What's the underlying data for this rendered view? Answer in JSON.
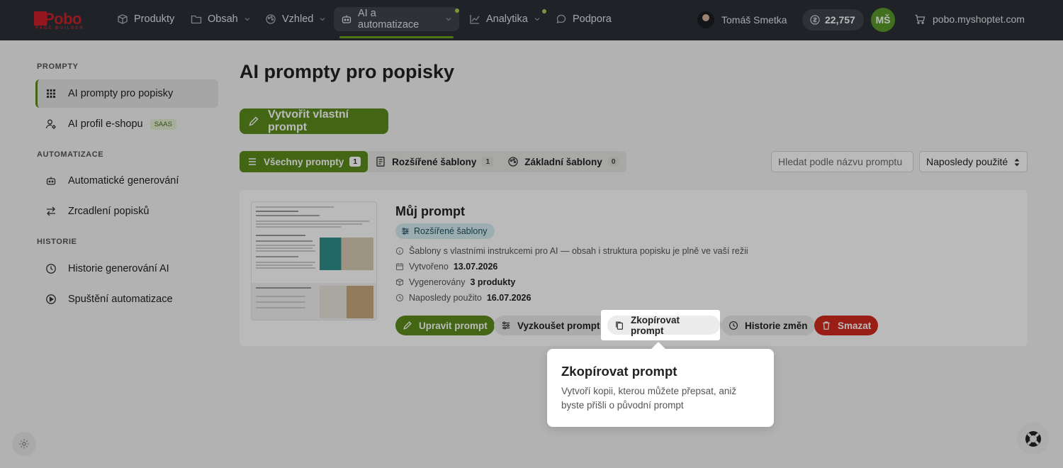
{
  "topbar": {
    "logo": {
      "text": "Pobo",
      "subtext": "PAGE BUILDER"
    },
    "nav": [
      {
        "label": "Produkty",
        "icon": "box-icon"
      },
      {
        "label": "Obsah",
        "icon": "folder-icon"
      },
      {
        "label": "Vzhled",
        "icon": "palette-icon"
      },
      {
        "label": "AI a automatizace",
        "icon": "robot-icon",
        "active": true
      },
      {
        "label": "Analytika",
        "icon": "chart-icon"
      },
      {
        "label": "Podpora",
        "icon": "chat-icon"
      }
    ],
    "user_name": "Tomáš Smetka",
    "credits": "22,757",
    "initials": "MŠ",
    "shop": "pobo.myshoptet.com"
  },
  "sidebar": {
    "sections": [
      {
        "title": "PROMPTY",
        "items": [
          {
            "label": "AI prompty pro popisky",
            "icon": "grid-icon",
            "active": true
          },
          {
            "label": "AI profil e-shopu",
            "icon": "user-gear-icon",
            "badge": "SAAS"
          }
        ]
      },
      {
        "title": "AUTOMATIZACE",
        "items": [
          {
            "label": "Automatické generování",
            "icon": "robot-icon"
          },
          {
            "label": "Zrcadlení popisků",
            "icon": "swap-icon"
          }
        ]
      },
      {
        "title": "HISTORIE",
        "items": [
          {
            "label": "Historie generování AI",
            "icon": "clock-icon"
          },
          {
            "label": "Spuštění automatizace",
            "icon": "play-icon"
          }
        ]
      }
    ]
  },
  "main": {
    "title": "AI prompty pro popisky",
    "create_button": "Vytvořit vlastní prompt",
    "tabs": [
      {
        "label": "Všechny prompty",
        "count": "1",
        "active": true
      },
      {
        "label": "Rozšířené šablony",
        "count": "1"
      },
      {
        "label": "Základní šablony",
        "count": "0"
      }
    ],
    "search_placeholder": "Hledat podle názvu promptu",
    "sort_value": "Naposledy použité",
    "card": {
      "title": "Můj prompt",
      "badge": "Rozšířené šablony",
      "info": "Šablony s vlastními instrukcemi pro AI — obsah i struktura popisku je plně ve vaší režii",
      "created_label": "Vytvořeno",
      "created_value": "13.07.2026",
      "generated_label": "Vygenerovány",
      "generated_value": "3 produkty",
      "last_used_label": "Naposledy použito",
      "last_used_value": "16.07.2026",
      "actions": {
        "edit": "Upravit prompt",
        "try": "Vyzkoušet prompt",
        "copy": "Zkopírovat prompt",
        "history": "Historie změn",
        "delete": "Smazat"
      }
    }
  },
  "tooltip": {
    "title": "Zkopírovat prompt",
    "body": "Vytvoří kopii, kterou můžete přepsat, aniž byste přišli o původní prompt"
  },
  "colors": {
    "topbar": "#2b3037",
    "primary": "#5d8c1e",
    "danger": "#d22b1f",
    "badge_bg": "#d6edf3"
  }
}
